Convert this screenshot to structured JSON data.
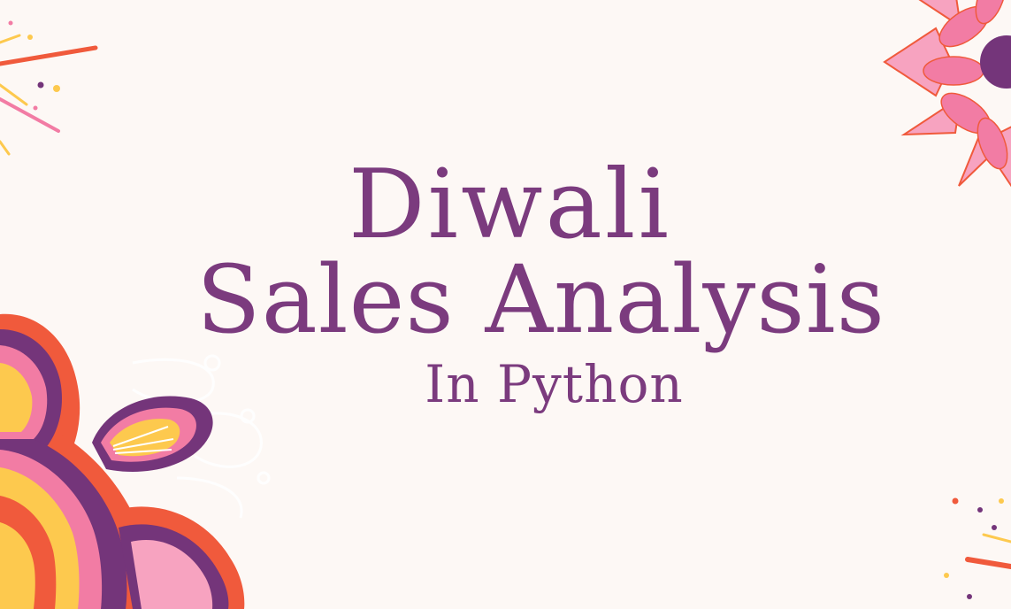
{
  "title": {
    "line_1": "Diwali",
    "line_2": "Sales Analysis",
    "line_3": "In Python"
  },
  "colors": {
    "background": "#fdf8f5",
    "title": "#7b3b7e",
    "purple": "#74357a",
    "orange": "#f05a3c",
    "pink": "#f27ca4",
    "yellow": "#fdc94e",
    "light_pink": "#f7a3c0"
  },
  "decorations": {
    "top_left": "firework-burst",
    "top_right": "pink-mandala-flower",
    "bottom_left": "layered-mandala-flower",
    "bottom_right": "firework-burst"
  }
}
